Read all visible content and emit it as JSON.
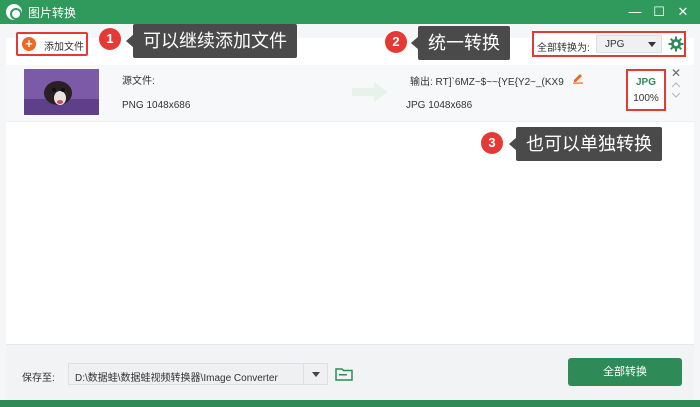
{
  "window": {
    "title": "图片转换",
    "minimize": "—",
    "maximize": "☐",
    "close": "✕"
  },
  "toolbar": {
    "add_file_label": "添加文件",
    "convert_all_label": "全部转换为:",
    "format_value": "JPG"
  },
  "callouts": [
    {
      "number": "1",
      "text": "可以继续添加文件"
    },
    {
      "number": "2",
      "text": "统一转换"
    },
    {
      "number": "3",
      "text": "也可以单独转换"
    }
  ],
  "file": {
    "source_label": "源文件:",
    "source_meta": "PNG   1048x686",
    "output_label": "输出: RT]`6MZ~$~~{YE{Y2~_(KX9",
    "output_meta": "JPG   1048x686",
    "format": "JPG",
    "progress": "100%",
    "progress_value": 1.0
  },
  "bottom": {
    "save_label": "保存至:",
    "path": "D:\\数据蛙\\数据蛙视频转换器\\Image Converter",
    "convert_button": "全部转换"
  },
  "colors": {
    "brand_green": "#2e8b57",
    "accent_red": "#e53935",
    "add_orange": "#f26522"
  }
}
